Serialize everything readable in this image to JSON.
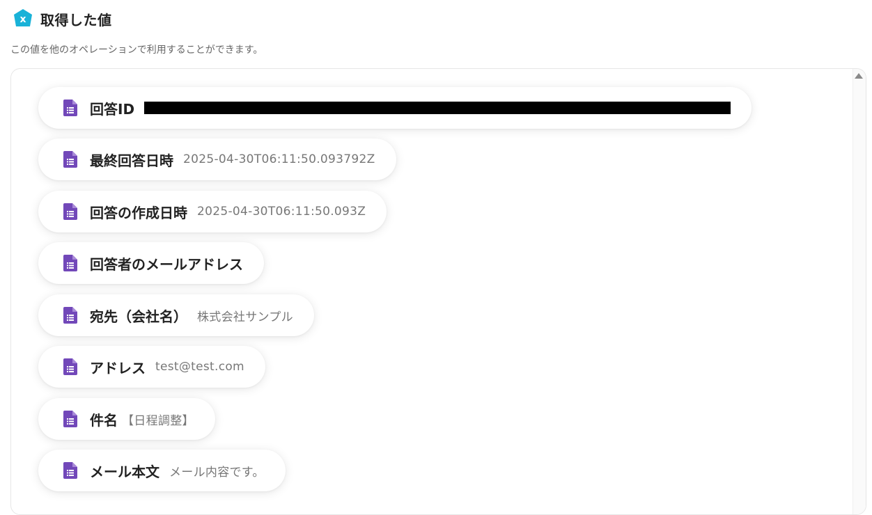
{
  "header": {
    "title": "取得した値",
    "description": "この値を他のオペレーションで利用することができます。",
    "icon": "yoom-x-icon",
    "brand_color": "#19b2d8"
  },
  "items_icon": "forms-document-icon",
  "icon_color": "#7248b9",
  "items": [
    {
      "label": "回答ID",
      "value": ""
    },
    {
      "label": "最終回答日時",
      "value": "2025-04-30T06:11:50.093792Z"
    },
    {
      "label": "回答の作成日時",
      "value": "2025-04-30T06:11:50.093Z"
    },
    {
      "label": "回答者のメールアドレス",
      "value": ""
    },
    {
      "label": "宛先（会社名）",
      "value": "株式会社サンプル"
    },
    {
      "label": "アドレス",
      "value": "test@test.com"
    },
    {
      "label": "件名",
      "value": "【日程調整】"
    },
    {
      "label": "メール本文",
      "value": "メール内容です。"
    }
  ]
}
